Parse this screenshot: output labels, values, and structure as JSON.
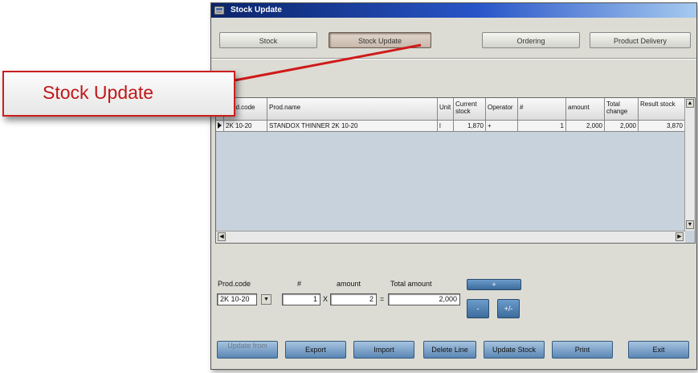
{
  "window": {
    "title": "Stock Update"
  },
  "tabs": [
    {
      "label": "Stock"
    },
    {
      "label": "Stock Update"
    },
    {
      "label": "Ordering"
    },
    {
      "label": "Product Delivery"
    }
  ],
  "grid": {
    "columns": [
      "Prod.code",
      "Prod.name",
      "Unit",
      "Current stock",
      "Operator",
      "#",
      "amount",
      "Total change",
      "Result stock"
    ],
    "rows": [
      {
        "prod_code": "2K 10-20",
        "prod_name": "STANDOX THINNER 2K 10-20",
        "unit": "l",
        "current_stock": "1,870",
        "operator": "+",
        "count": "1",
        "amount": "2,000",
        "total_change": "2,000",
        "result_stock": "3,870"
      }
    ]
  },
  "form": {
    "prod_code_label": "Prod.code",
    "count_label": "#",
    "amount_label": "amount",
    "total_label": "Total amount",
    "prod_code_value": "2K 10-20",
    "count_value": "1",
    "amount_value": "2",
    "total_value": "2,000",
    "times_sign": "X",
    "equals_sign": "=",
    "op_plus": "+",
    "op_minus": "-",
    "op_other": "+/-"
  },
  "actions": {
    "update_from": "Update from",
    "export": "Export",
    "import": "Import",
    "delete_line": "Delete Line",
    "update_stock": "Update Stock",
    "print": "Print",
    "exit": "Exit"
  },
  "callout": {
    "label": "Stock Update"
  },
  "colors": {
    "callout_border": "#cc1e1e",
    "callout_text": "#c01818",
    "titlebar": "#0a246a"
  }
}
